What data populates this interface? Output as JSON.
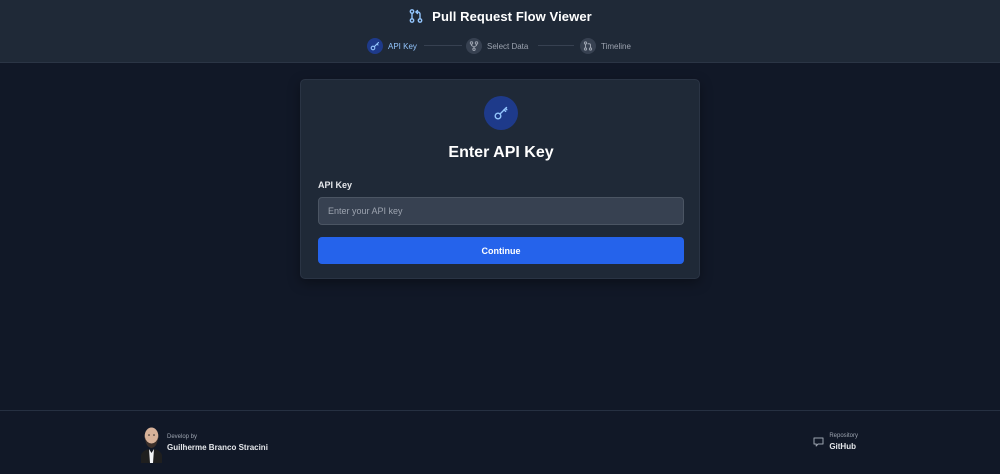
{
  "header": {
    "title": "Pull Request Flow Viewer",
    "logo_icon": "git-pull-request-icon"
  },
  "steps": [
    {
      "label": "API Key",
      "icon": "key-icon",
      "state": "active"
    },
    {
      "label": "Select Data",
      "icon": "git-branch-icon",
      "state": "inactive"
    },
    {
      "label": "Timeline",
      "icon": "git-pull-request-icon",
      "state": "inactive"
    }
  ],
  "card": {
    "icon": "key-icon",
    "title": "Enter API Key",
    "field_label": "API Key",
    "input_value": "",
    "input_placeholder": "Enter your API key",
    "button_label": "Continue"
  },
  "footer": {
    "developer_caption": "Develop by",
    "developer_name": "Guilherme Branco Stracini",
    "repo_caption": "Repository",
    "repo_link": "GitHub"
  },
  "colors": {
    "background": "#111827",
    "surface": "#1f2937",
    "accent": "#2563eb",
    "active_step": "#93c5fd"
  }
}
